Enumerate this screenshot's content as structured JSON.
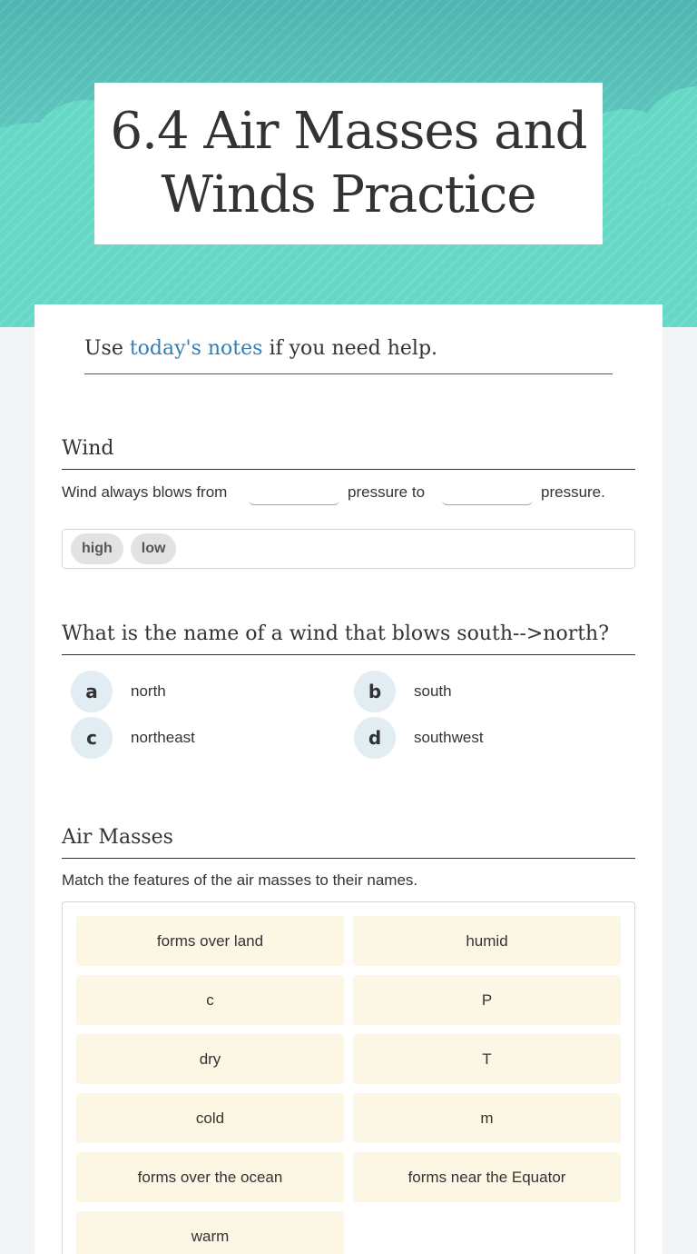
{
  "title": "6.4 Air Masses and Winds Practice",
  "instruction": {
    "prefix": "Use ",
    "link": "today's notes",
    "suffix": " if you need help."
  },
  "wind_section": {
    "title": "Wind",
    "sentence_part1": "Wind always blows from",
    "sentence_part2": "pressure to",
    "sentence_part3": "pressure.",
    "word_bank": [
      "high",
      "low"
    ]
  },
  "question": {
    "title": "What is the name of a wind that blows south-->north?",
    "options": [
      {
        "letter": "a",
        "label": "north"
      },
      {
        "letter": "b",
        "label": "south"
      },
      {
        "letter": "c",
        "label": "northeast"
      },
      {
        "letter": "d",
        "label": "southwest"
      }
    ]
  },
  "air_masses": {
    "title": "Air Masses",
    "instruction": "Match the features of the air masses to their names.",
    "cards_left": [
      "forms over land",
      "c",
      "dry",
      "cold",
      "forms over the ocean",
      "warm"
    ],
    "cards_right": [
      "humid",
      "P",
      "T",
      "m",
      "forms near the Equator"
    ]
  },
  "colors": {
    "header_teal": "#5cc9b6",
    "link_blue": "#2f7fb8",
    "card_cream": "#fcf7e4",
    "badge_blue": "#e1edf3"
  }
}
